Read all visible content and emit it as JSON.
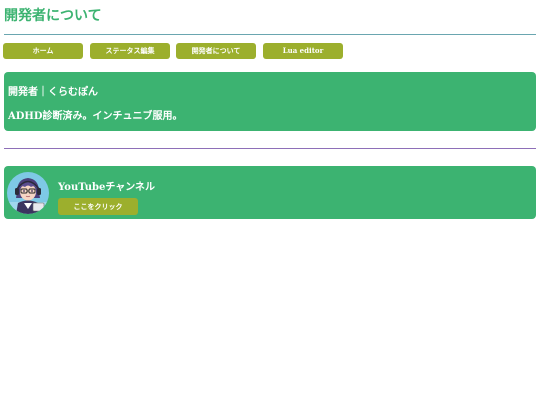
{
  "page": {
    "title": "開発者について"
  },
  "nav": {
    "items": [
      {
        "label": "ホーム"
      },
      {
        "label": "ステータス編集"
      },
      {
        "label": "開発者について"
      },
      {
        "label": "Lua editor"
      }
    ]
  },
  "developer": {
    "name": "開発者｜くらむぽん",
    "description": "ADHD診断済み。インチュニブ服用。"
  },
  "youtube": {
    "title": "YouTubeチャンネル",
    "link_label": "ここをクリック",
    "avatar_icon": "character-avatar-icon"
  },
  "colors": {
    "accent_green": "#3cb371",
    "button_olive": "#9caf2d"
  }
}
